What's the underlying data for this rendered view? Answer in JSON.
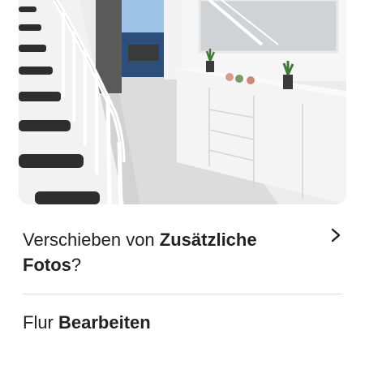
{
  "photo": {
    "description_icon": "hallway-photo"
  },
  "move_prompt": {
    "prefix": "Verschieben von ",
    "target": "Zusätzliche Fotos",
    "suffix": "?",
    "icon": "chevron-right-icon"
  },
  "room": {
    "name": "Flur",
    "action": "Bearbeiten"
  },
  "colors": {
    "text": "#222222",
    "divider": "#dddddd"
  }
}
